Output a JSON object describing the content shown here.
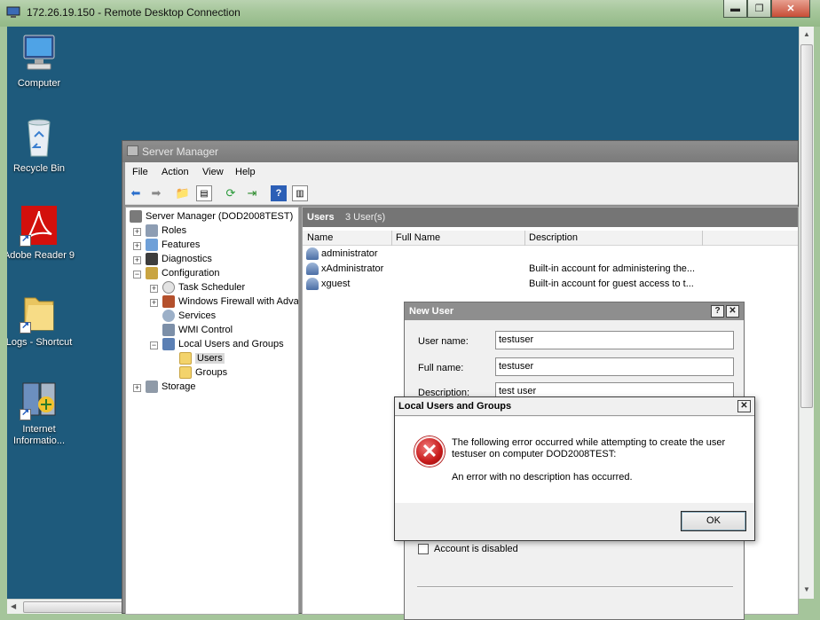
{
  "rdp": {
    "title": "172.26.19.150 - Remote Desktop Connection",
    "minimize": "▬",
    "restore": "❐",
    "close": "✕"
  },
  "desktop_icons": [
    {
      "label": "Computer"
    },
    {
      "label": "Recycle Bin"
    },
    {
      "label": "Adobe Reader 9"
    },
    {
      "label": "Logs - Shortcut"
    },
    {
      "label": "Internet Informatio..."
    }
  ],
  "server_manager": {
    "title": "Server Manager",
    "menu": [
      "File",
      "Action",
      "View",
      "Help"
    ],
    "tree": {
      "root": "Server Manager (DOD2008TEST)",
      "roles": "Roles",
      "features": "Features",
      "diagnostics": "Diagnostics",
      "configuration": "Configuration",
      "task_scheduler": "Task Scheduler",
      "firewall": "Windows Firewall with Adva",
      "services": "Services",
      "wmi": "WMI Control",
      "local_users_groups": "Local Users and Groups",
      "users": "Users",
      "groups": "Groups",
      "storage": "Storage"
    },
    "pane": {
      "header": "Users",
      "count": "3 User(s)",
      "columns": [
        "Name",
        "Full Name",
        "Description"
      ],
      "rows": [
        {
          "name": "administrator",
          "full_name": "",
          "description": ""
        },
        {
          "name": "xAdministrator",
          "full_name": "",
          "description": "Built-in account for administering the..."
        },
        {
          "name": "xguest",
          "full_name": "",
          "description": "Built-in account for guest access to t..."
        }
      ]
    }
  },
  "new_user": {
    "title": "New User",
    "help_btn": "?",
    "close_btn": "✕",
    "user_name_label": "User name:",
    "user_name_value": "testuser",
    "full_name_label": "Full name:",
    "full_name_value": "testuser",
    "description_label": "Description:",
    "description_value": "test user",
    "account_disabled_label": "Account is disabled"
  },
  "error_dialog": {
    "title": "Local Users and Groups",
    "close_btn": "✕",
    "line1": "The following error occurred while attempting to create the user",
    "line2": "testuser on computer DOD2008TEST:",
    "line3": "An error with no description has occurred.",
    "ok": "OK"
  }
}
